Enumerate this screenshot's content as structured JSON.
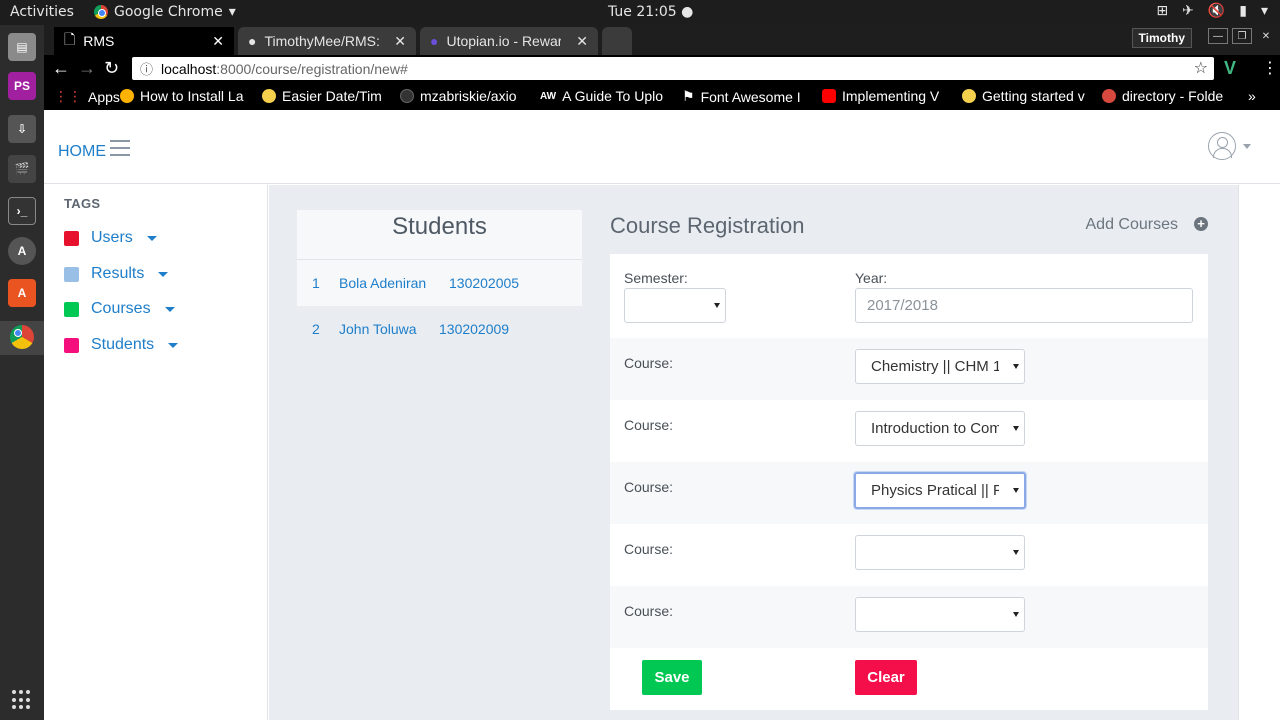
{
  "os": {
    "activities": "Activities",
    "app_name": "Google Chrome",
    "clock": "Tue 21:05 ●"
  },
  "browser": {
    "tabs": [
      {
        "title": "RMS"
      },
      {
        "title": "TimothyMee/RMS: I"
      },
      {
        "title": "Utopian.io - Reward"
      }
    ],
    "user": "Timothy",
    "url_host": "localhost",
    "url_path": ":8000/course/registration/new#",
    "bookmarks": [
      {
        "label": "Apps",
        "color": "#e94235"
      },
      {
        "label": "How to Install La",
        "color": "#ffb300"
      },
      {
        "label": "Easier Date/Tim",
        "color": "#f5d04c"
      },
      {
        "label": "mzabriskie/axio",
        "color": "#333333"
      },
      {
        "label": "A Guide To Uplo",
        "color": "#000000"
      },
      {
        "label": "Font Awesome I",
        "color": "#ffffff"
      },
      {
        "label": "Implementing V",
        "color": "#ff0000"
      },
      {
        "label": "Getting started v",
        "color": "#f5d04c"
      },
      {
        "label": "directory - Folde",
        "color": "#d7483e"
      }
    ],
    "more": "»"
  },
  "app": {
    "home": "HOME",
    "tags_title": "TAGS",
    "sidebar": [
      {
        "label": "Users",
        "color": "#e8112d"
      },
      {
        "label": "Results",
        "color": "#99bfe6"
      },
      {
        "label": "Courses",
        "color": "#00c853"
      },
      {
        "label": "Students",
        "color": "#f50f7d"
      }
    ],
    "students": {
      "title": "Students",
      "rows": [
        {
          "num": "1",
          "name": "Bola Adeniran",
          "matric": "130202005"
        },
        {
          "num": "2",
          "name": "John Toluwa",
          "matric": "130202009"
        }
      ]
    },
    "registration": {
      "title": "Course Registration",
      "add_courses": "Add Courses",
      "semester_label": "Semester:",
      "semester_value": "",
      "year_label": "Year:",
      "year_placeholder": "2017/2018",
      "course_label": "Course:",
      "courses": [
        {
          "value": "Chemistry || CHM 1"
        },
        {
          "value": "Introduction to Com"
        },
        {
          "value": "Physics Pratical || P"
        },
        {
          "value": ""
        },
        {
          "value": ""
        }
      ],
      "save_label": "Save",
      "clear_label": "Clear",
      "save_color": "#00c853",
      "clear_color": "#f50f4a"
    }
  }
}
